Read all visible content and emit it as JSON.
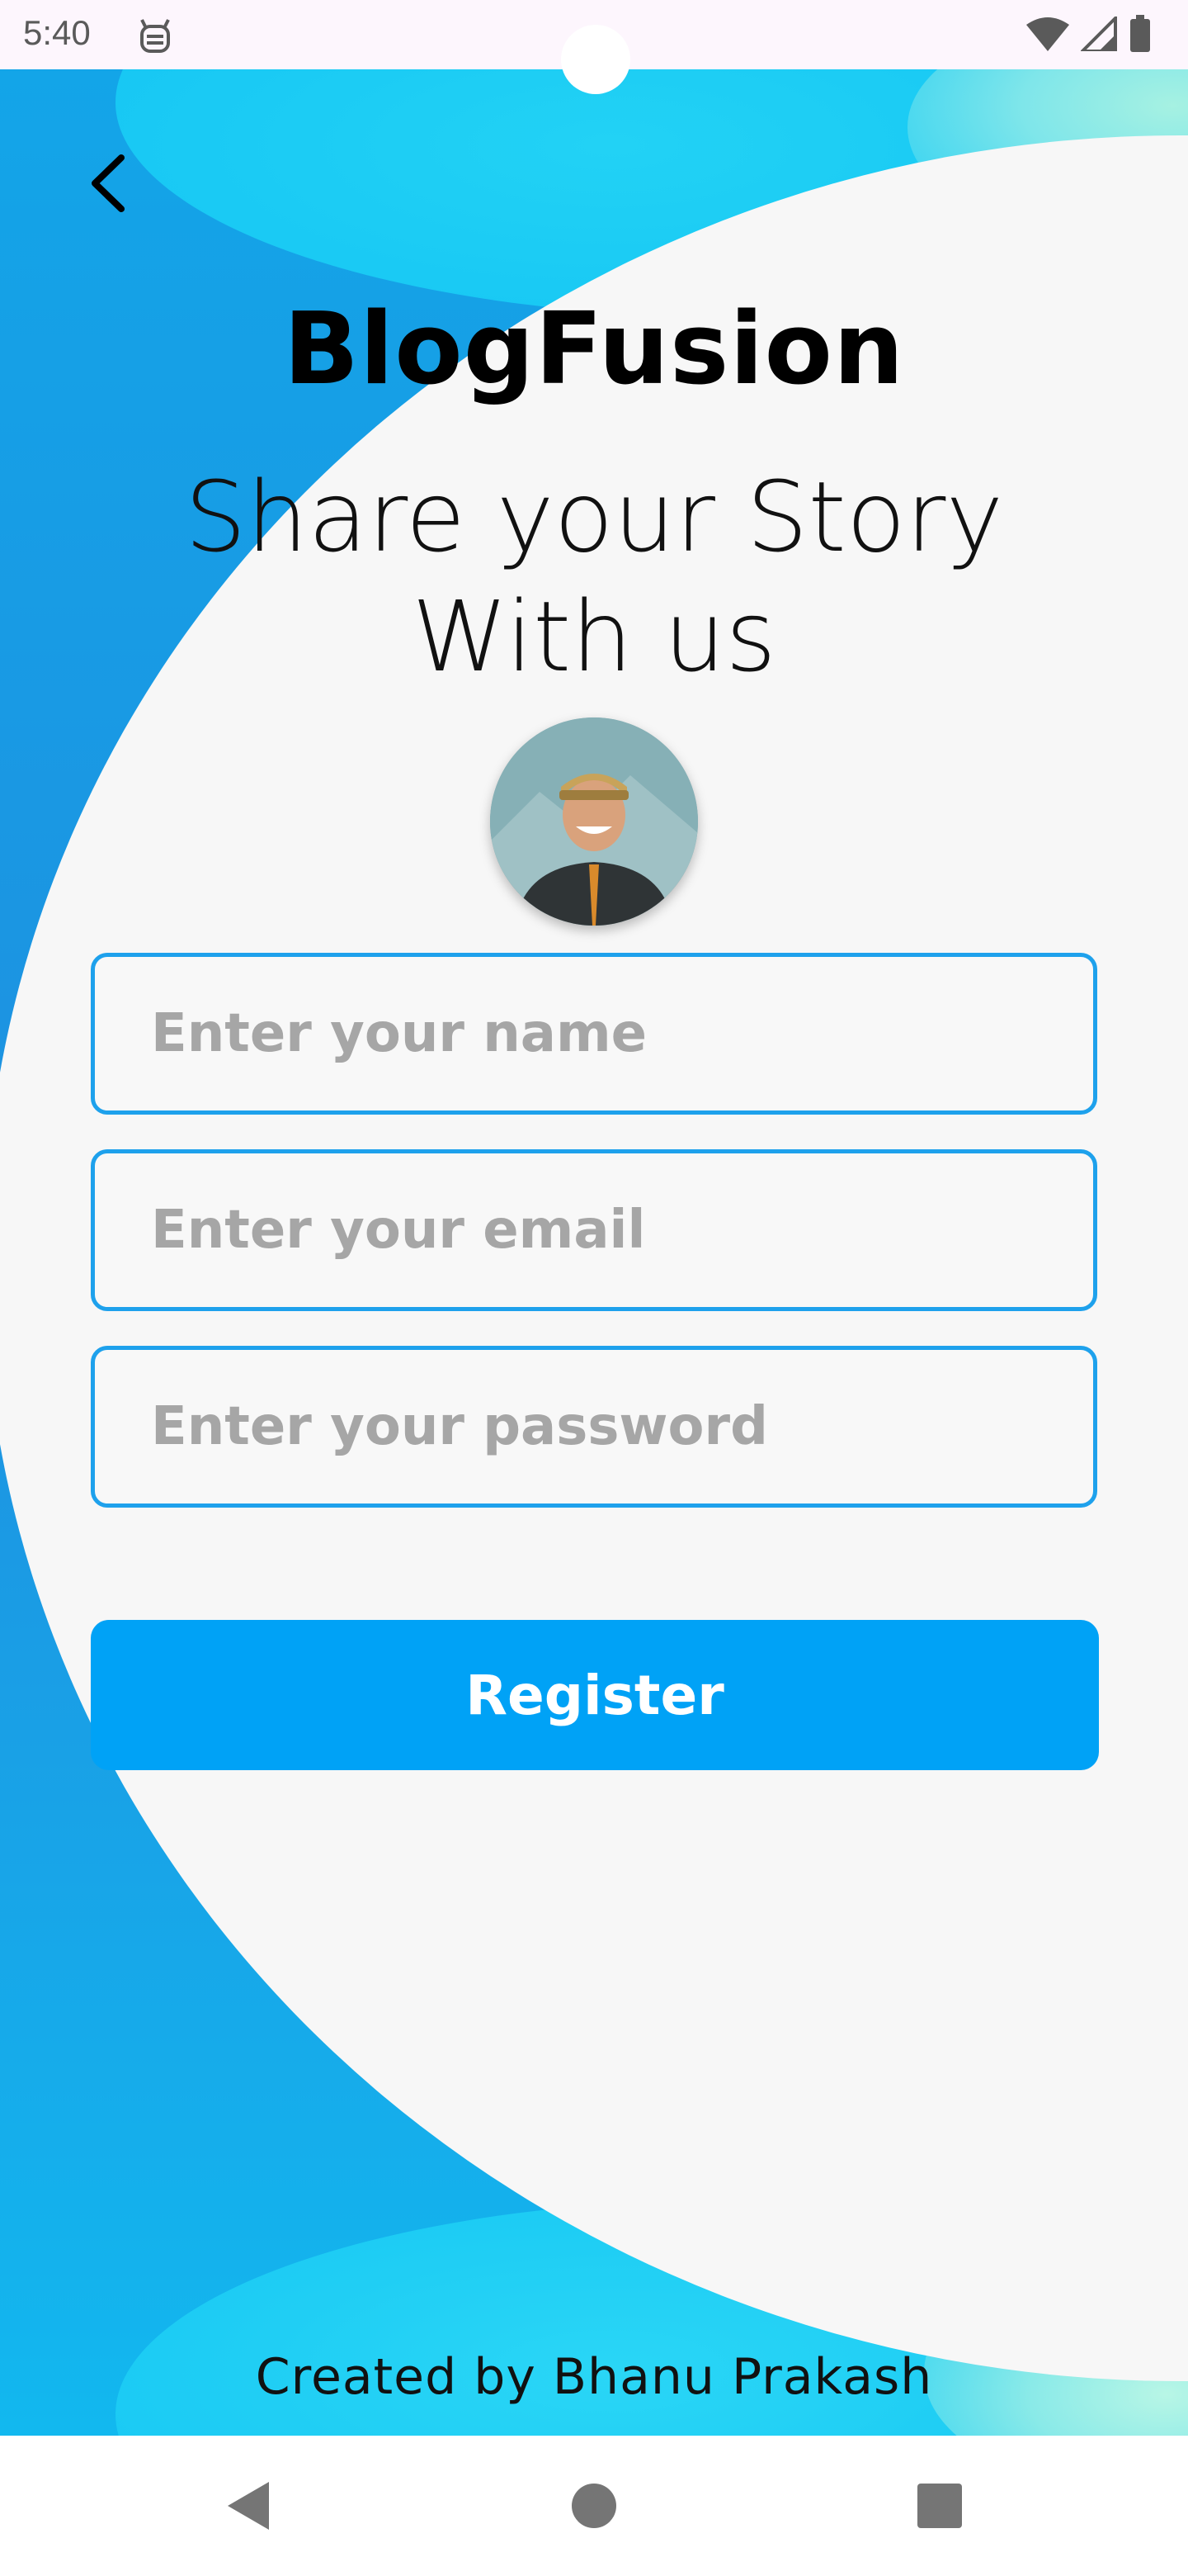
{
  "status_bar": {
    "time": "5:40",
    "app_icon": "android-face-icon",
    "indicators": [
      "wifi-icon",
      "signal-icon",
      "battery-icon"
    ]
  },
  "header": {
    "back_icon": "chevron-left-icon",
    "title": "BlogFusion",
    "tagline_line1": "Share your Story",
    "tagline_line2": "With us"
  },
  "profile": {
    "avatar": "profile-photo"
  },
  "form": {
    "name_placeholder": "Enter your name",
    "email_placeholder": "Enter your email",
    "password_placeholder": "Enter your password",
    "name_value": "",
    "email_value": "",
    "password_value": "",
    "register_label": "Register"
  },
  "footer": {
    "credit": "Created by Bhanu Prakash"
  },
  "nav_bar": {
    "items": [
      "back-triangle-icon",
      "home-circle-icon",
      "recents-square-icon"
    ]
  },
  "colors": {
    "accent": "#00a2f6",
    "field_border": "#1ea1ec",
    "background_blue": "#13a5e8",
    "panel": "#f7f7f7"
  }
}
